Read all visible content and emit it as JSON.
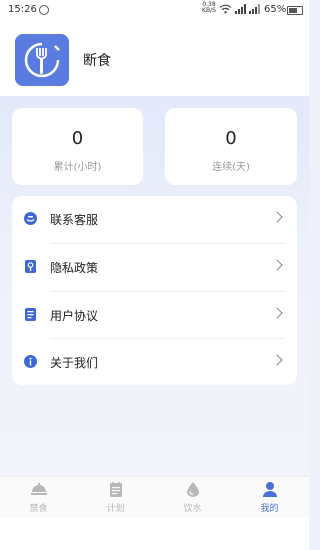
{
  "status_bar": {
    "time": "15:26",
    "net_speed_value": "0.38",
    "net_speed_unit": "KB/S",
    "battery_percent": "65%"
  },
  "profile": {
    "app_name": "断食",
    "logo_icon": "fork-clock-icon",
    "logo_color": "#5a7ce0"
  },
  "stats": [
    {
      "value": "0",
      "label": "累计(小时)"
    },
    {
      "value": "0",
      "label": "连续(天)"
    }
  ],
  "menu": [
    {
      "label": "联系客服",
      "icon": "customer-service-icon",
      "color": "#3f68d6"
    },
    {
      "label": "隐私政策",
      "icon": "privacy-lock-icon",
      "color": "#3f68d6"
    },
    {
      "label": "用户协议",
      "icon": "user-agreement-icon",
      "color": "#3f68d6"
    },
    {
      "label": "关于我们",
      "icon": "info-icon",
      "color": "#3f68d6"
    }
  ],
  "tabs": [
    {
      "label": "禁食",
      "icon": "fasting-icon",
      "active": false
    },
    {
      "label": "计划",
      "icon": "plan-calendar-icon",
      "active": false
    },
    {
      "label": "饮水",
      "icon": "water-drop-icon",
      "active": false
    },
    {
      "label": "我的",
      "icon": "profile-icon",
      "active": true
    }
  ],
  "colors": {
    "accent": "#4a6fd8",
    "inactive_tab": "#b8b8b8",
    "background": "#eef1fa"
  }
}
